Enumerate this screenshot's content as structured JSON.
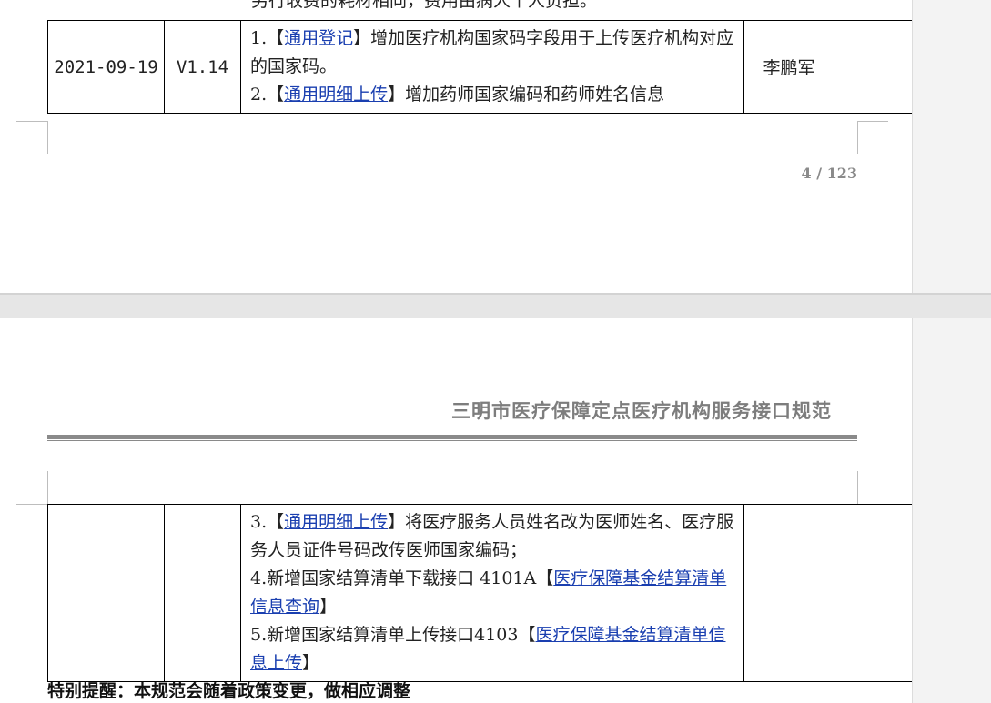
{
  "top_page": {
    "cut_line": "另行收费的耗材相同，费用由病人个人负担。",
    "row": {
      "date": "2021-09-19",
      "version": "V1.14",
      "items": [
        {
          "prefix": "1.【",
          "link": "通用登记",
          "suffix": "】增加医疗机构国家码字段用于上传医疗机构对应的国家码。"
        },
        {
          "prefix": "2.【",
          "link": "通用明细上传",
          "suffix": "】增加药师国家编码和药师姓名信息"
        }
      ],
      "author": "李鹏军"
    },
    "page_number": "4 / 123"
  },
  "bottom_page": {
    "header_title": "三明市医疗保障定点医疗机构服务接口规范",
    "row_items": [
      {
        "prefix": "3.【",
        "link": "通用明细上传",
        "suffix": "】将医疗服务人员姓名改为医师姓名、医疗服务人员证件号码改传医师国家编码；"
      },
      {
        "prefix": "4.新增国家结算清单下载接口 4101A【",
        "link": "医疗保障基金结算清单信息查询",
        "suffix": "】"
      },
      {
        "prefix": "5.新增国家结算清单上传接口4103【",
        "link": "医疗保障基金结算清单信息上传",
        "suffix": "】"
      }
    ],
    "note": "特别提醒：本规范会随着政策变更，做相应调整"
  }
}
